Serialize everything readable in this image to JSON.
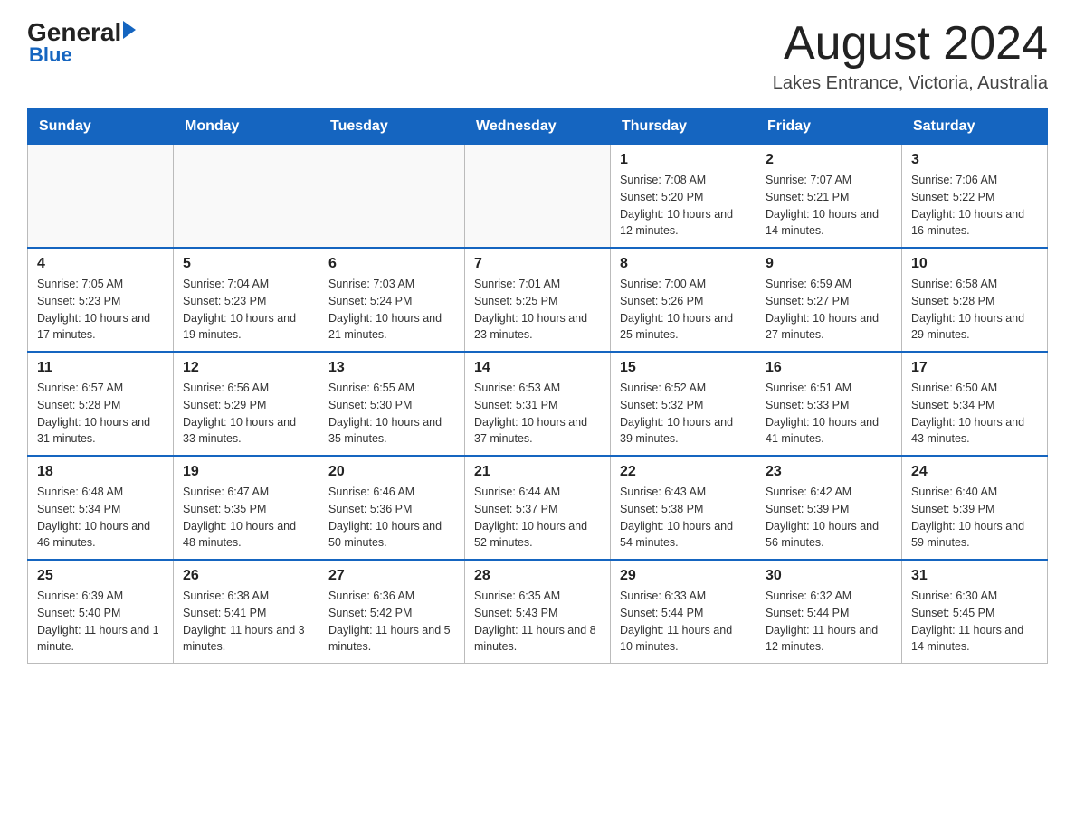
{
  "header": {
    "logo_general": "General",
    "logo_blue": "Blue",
    "month_title": "August 2024",
    "location": "Lakes Entrance, Victoria, Australia"
  },
  "days_of_week": [
    "Sunday",
    "Monday",
    "Tuesday",
    "Wednesday",
    "Thursday",
    "Friday",
    "Saturday"
  ],
  "weeks": [
    {
      "days": [
        {
          "number": "",
          "info": ""
        },
        {
          "number": "",
          "info": ""
        },
        {
          "number": "",
          "info": ""
        },
        {
          "number": "",
          "info": ""
        },
        {
          "number": "1",
          "info": "Sunrise: 7:08 AM\nSunset: 5:20 PM\nDaylight: 10 hours and 12 minutes."
        },
        {
          "number": "2",
          "info": "Sunrise: 7:07 AM\nSunset: 5:21 PM\nDaylight: 10 hours and 14 minutes."
        },
        {
          "number": "3",
          "info": "Sunrise: 7:06 AM\nSunset: 5:22 PM\nDaylight: 10 hours and 16 minutes."
        }
      ]
    },
    {
      "days": [
        {
          "number": "4",
          "info": "Sunrise: 7:05 AM\nSunset: 5:23 PM\nDaylight: 10 hours and 17 minutes."
        },
        {
          "number": "5",
          "info": "Sunrise: 7:04 AM\nSunset: 5:23 PM\nDaylight: 10 hours and 19 minutes."
        },
        {
          "number": "6",
          "info": "Sunrise: 7:03 AM\nSunset: 5:24 PM\nDaylight: 10 hours and 21 minutes."
        },
        {
          "number": "7",
          "info": "Sunrise: 7:01 AM\nSunset: 5:25 PM\nDaylight: 10 hours and 23 minutes."
        },
        {
          "number": "8",
          "info": "Sunrise: 7:00 AM\nSunset: 5:26 PM\nDaylight: 10 hours and 25 minutes."
        },
        {
          "number": "9",
          "info": "Sunrise: 6:59 AM\nSunset: 5:27 PM\nDaylight: 10 hours and 27 minutes."
        },
        {
          "number": "10",
          "info": "Sunrise: 6:58 AM\nSunset: 5:28 PM\nDaylight: 10 hours and 29 minutes."
        }
      ]
    },
    {
      "days": [
        {
          "number": "11",
          "info": "Sunrise: 6:57 AM\nSunset: 5:28 PM\nDaylight: 10 hours and 31 minutes."
        },
        {
          "number": "12",
          "info": "Sunrise: 6:56 AM\nSunset: 5:29 PM\nDaylight: 10 hours and 33 minutes."
        },
        {
          "number": "13",
          "info": "Sunrise: 6:55 AM\nSunset: 5:30 PM\nDaylight: 10 hours and 35 minutes."
        },
        {
          "number": "14",
          "info": "Sunrise: 6:53 AM\nSunset: 5:31 PM\nDaylight: 10 hours and 37 minutes."
        },
        {
          "number": "15",
          "info": "Sunrise: 6:52 AM\nSunset: 5:32 PM\nDaylight: 10 hours and 39 minutes."
        },
        {
          "number": "16",
          "info": "Sunrise: 6:51 AM\nSunset: 5:33 PM\nDaylight: 10 hours and 41 minutes."
        },
        {
          "number": "17",
          "info": "Sunrise: 6:50 AM\nSunset: 5:34 PM\nDaylight: 10 hours and 43 minutes."
        }
      ]
    },
    {
      "days": [
        {
          "number": "18",
          "info": "Sunrise: 6:48 AM\nSunset: 5:34 PM\nDaylight: 10 hours and 46 minutes."
        },
        {
          "number": "19",
          "info": "Sunrise: 6:47 AM\nSunset: 5:35 PM\nDaylight: 10 hours and 48 minutes."
        },
        {
          "number": "20",
          "info": "Sunrise: 6:46 AM\nSunset: 5:36 PM\nDaylight: 10 hours and 50 minutes."
        },
        {
          "number": "21",
          "info": "Sunrise: 6:44 AM\nSunset: 5:37 PM\nDaylight: 10 hours and 52 minutes."
        },
        {
          "number": "22",
          "info": "Sunrise: 6:43 AM\nSunset: 5:38 PM\nDaylight: 10 hours and 54 minutes."
        },
        {
          "number": "23",
          "info": "Sunrise: 6:42 AM\nSunset: 5:39 PM\nDaylight: 10 hours and 56 minutes."
        },
        {
          "number": "24",
          "info": "Sunrise: 6:40 AM\nSunset: 5:39 PM\nDaylight: 10 hours and 59 minutes."
        }
      ]
    },
    {
      "days": [
        {
          "number": "25",
          "info": "Sunrise: 6:39 AM\nSunset: 5:40 PM\nDaylight: 11 hours and 1 minute."
        },
        {
          "number": "26",
          "info": "Sunrise: 6:38 AM\nSunset: 5:41 PM\nDaylight: 11 hours and 3 minutes."
        },
        {
          "number": "27",
          "info": "Sunrise: 6:36 AM\nSunset: 5:42 PM\nDaylight: 11 hours and 5 minutes."
        },
        {
          "number": "28",
          "info": "Sunrise: 6:35 AM\nSunset: 5:43 PM\nDaylight: 11 hours and 8 minutes."
        },
        {
          "number": "29",
          "info": "Sunrise: 6:33 AM\nSunset: 5:44 PM\nDaylight: 11 hours and 10 minutes."
        },
        {
          "number": "30",
          "info": "Sunrise: 6:32 AM\nSunset: 5:44 PM\nDaylight: 11 hours and 12 minutes."
        },
        {
          "number": "31",
          "info": "Sunrise: 6:30 AM\nSunset: 5:45 PM\nDaylight: 11 hours and 14 minutes."
        }
      ]
    }
  ]
}
